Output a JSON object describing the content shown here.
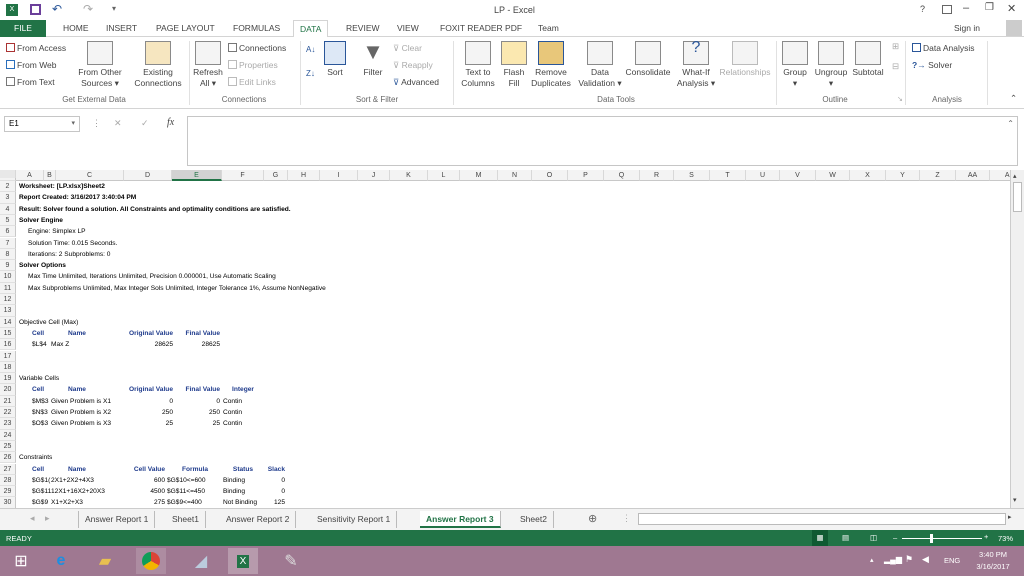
{
  "window": {
    "title": "LP - Excel",
    "help": "?",
    "sign_in": "Sign in"
  },
  "tabs": [
    "FILE",
    "HOME",
    "INSERT",
    "PAGE LAYOUT",
    "FORMULAS",
    "DATA",
    "REVIEW",
    "VIEW",
    "FOXIT READER PDF",
    "Team"
  ],
  "active_tab": "DATA",
  "ribbon": {
    "get_external": {
      "from_access": "From Access",
      "from_web": "From Web",
      "from_text": "From Text",
      "from_other_1": "From Other",
      "from_other_2": "Sources ▾",
      "existing_1": "Existing",
      "existing_2": "Connections",
      "label": "Get External Data"
    },
    "connections": {
      "refresh_1": "Refresh",
      "refresh_2": "All ▾",
      "connections": "Connections",
      "properties": "Properties",
      "edit_links": "Edit Links",
      "label": "Connections"
    },
    "sort_filter": {
      "sort": "Sort",
      "filter": "Filter",
      "clear": "Clear",
      "reapply": "Reapply",
      "advanced": "Advanced",
      "label": "Sort & Filter"
    },
    "data_tools": {
      "text_to_1": "Text to",
      "text_to_2": "Columns",
      "flash_1": "Flash",
      "flash_2": "Fill",
      "remove_1": "Remove",
      "remove_2": "Duplicates",
      "validation_1": "Data",
      "validation_2": "Validation ▾",
      "consolidate": "Consolidate",
      "whatif_1": "What-If",
      "whatif_2": "Analysis ▾",
      "relationships": "Relationships",
      "label": "Data Tools"
    },
    "outline": {
      "group": "Group",
      "ungroup": "Ungroup",
      "subtotal": "Subtotal",
      "label": "Outline"
    },
    "analysis": {
      "data_analysis": "Data Analysis",
      "solver": "Solver",
      "label": "Analysis"
    }
  },
  "formula_bar": {
    "name_box": "E1",
    "fx": "fx",
    "value": ""
  },
  "columns": [
    "A",
    "B",
    "C",
    "D",
    "E",
    "F",
    "G",
    "H",
    "I",
    "J",
    "K",
    "L",
    "M",
    "N",
    "O",
    "P",
    "Q",
    "R",
    "S",
    "T",
    "U",
    "V",
    "W",
    "X",
    "Y",
    "Z",
    "AA",
    "AB"
  ],
  "selected_column": "E",
  "rows": [
    "1",
    "2",
    "3",
    "4",
    "5",
    "6",
    "7",
    "8",
    "9",
    "10",
    "11",
    "12",
    "13",
    "14",
    "15",
    "16",
    "17",
    "18",
    "19",
    "20",
    "21",
    "22",
    "23",
    "24",
    "25",
    "26",
    "27",
    "28",
    "29",
    "30"
  ],
  "report": {
    "worksheet": "Worksheet: [LP.xlsx]Sheet2",
    "created": "Report Created: 3/16/2017 3:40:04 PM",
    "result": "Result: Solver found a solution.  All Constraints and optimality conditions are satisfied.",
    "engine_title": "Solver Engine",
    "engine": "Engine: Simplex LP",
    "time": "Solution Time: 0.015 Seconds.",
    "iterations": "Iterations: 2 Subproblems: 0",
    "options_title": "Solver Options",
    "options_1": "Max Time Unlimited,  Iterations Unlimited, Precision 0.000001, Use Automatic Scaling",
    "options_2": "Max Subproblems Unlimited, Max Integer Sols Unlimited, Integer Tolerance 1%, Assume NonNegative"
  },
  "objective": {
    "title": "Objective Cell (Max)",
    "headers": [
      "Cell",
      "Name",
      "Original Value",
      "Final Value"
    ],
    "rows": [
      [
        "$L$4",
        "Max Z",
        "28625",
        "28625"
      ]
    ]
  },
  "variables": {
    "title": "Variable Cells",
    "headers": [
      "Cell",
      "Name",
      "Original Value",
      "Final Value",
      "Integer"
    ],
    "rows": [
      [
        "$M$3",
        "Given Problem is X1",
        "0",
        "0",
        "Contin"
      ],
      [
        "$N$3",
        "Given Problem is X2",
        "250",
        "250",
        "Contin"
      ],
      [
        "$O$3",
        "Given Problem is X3",
        "25",
        "25",
        "Contin"
      ]
    ]
  },
  "constraints": {
    "title": "Constraints",
    "headers": [
      "Cell",
      "Name",
      "Cell Value",
      "Formula",
      "Status",
      "Slack"
    ],
    "rows": [
      [
        "$G$1(",
        "2X1+2X2+4X3",
        "600",
        "$G$10<=600",
        "Binding",
        "0"
      ],
      [
        "$G$11",
        "12X1+16X2+20X3",
        "4500",
        "$G$11<=450",
        "Binding",
        "0"
      ],
      [
        "$G$9",
        "X1+X2+X3",
        "275",
        "$G$9<=400",
        "Not Binding",
        "125"
      ]
    ]
  },
  "sheet_tabs": [
    "Answer Report 1",
    "Sheet1",
    "Answer Report 2",
    "Sensitivity Report 1",
    "Answer Report 3",
    "Sheet2"
  ],
  "active_sheet": "Answer Report 3",
  "status": {
    "ready": "READY",
    "zoom": "73%",
    "zoom_value": 73
  },
  "taskbar": {
    "lang": "ENG",
    "time": "3:40 PM",
    "date": "3/16/2017"
  },
  "colors": {
    "excel_green": "#217346",
    "taskbar": "#9f7891",
    "header_blue": "#1f3b8c"
  }
}
